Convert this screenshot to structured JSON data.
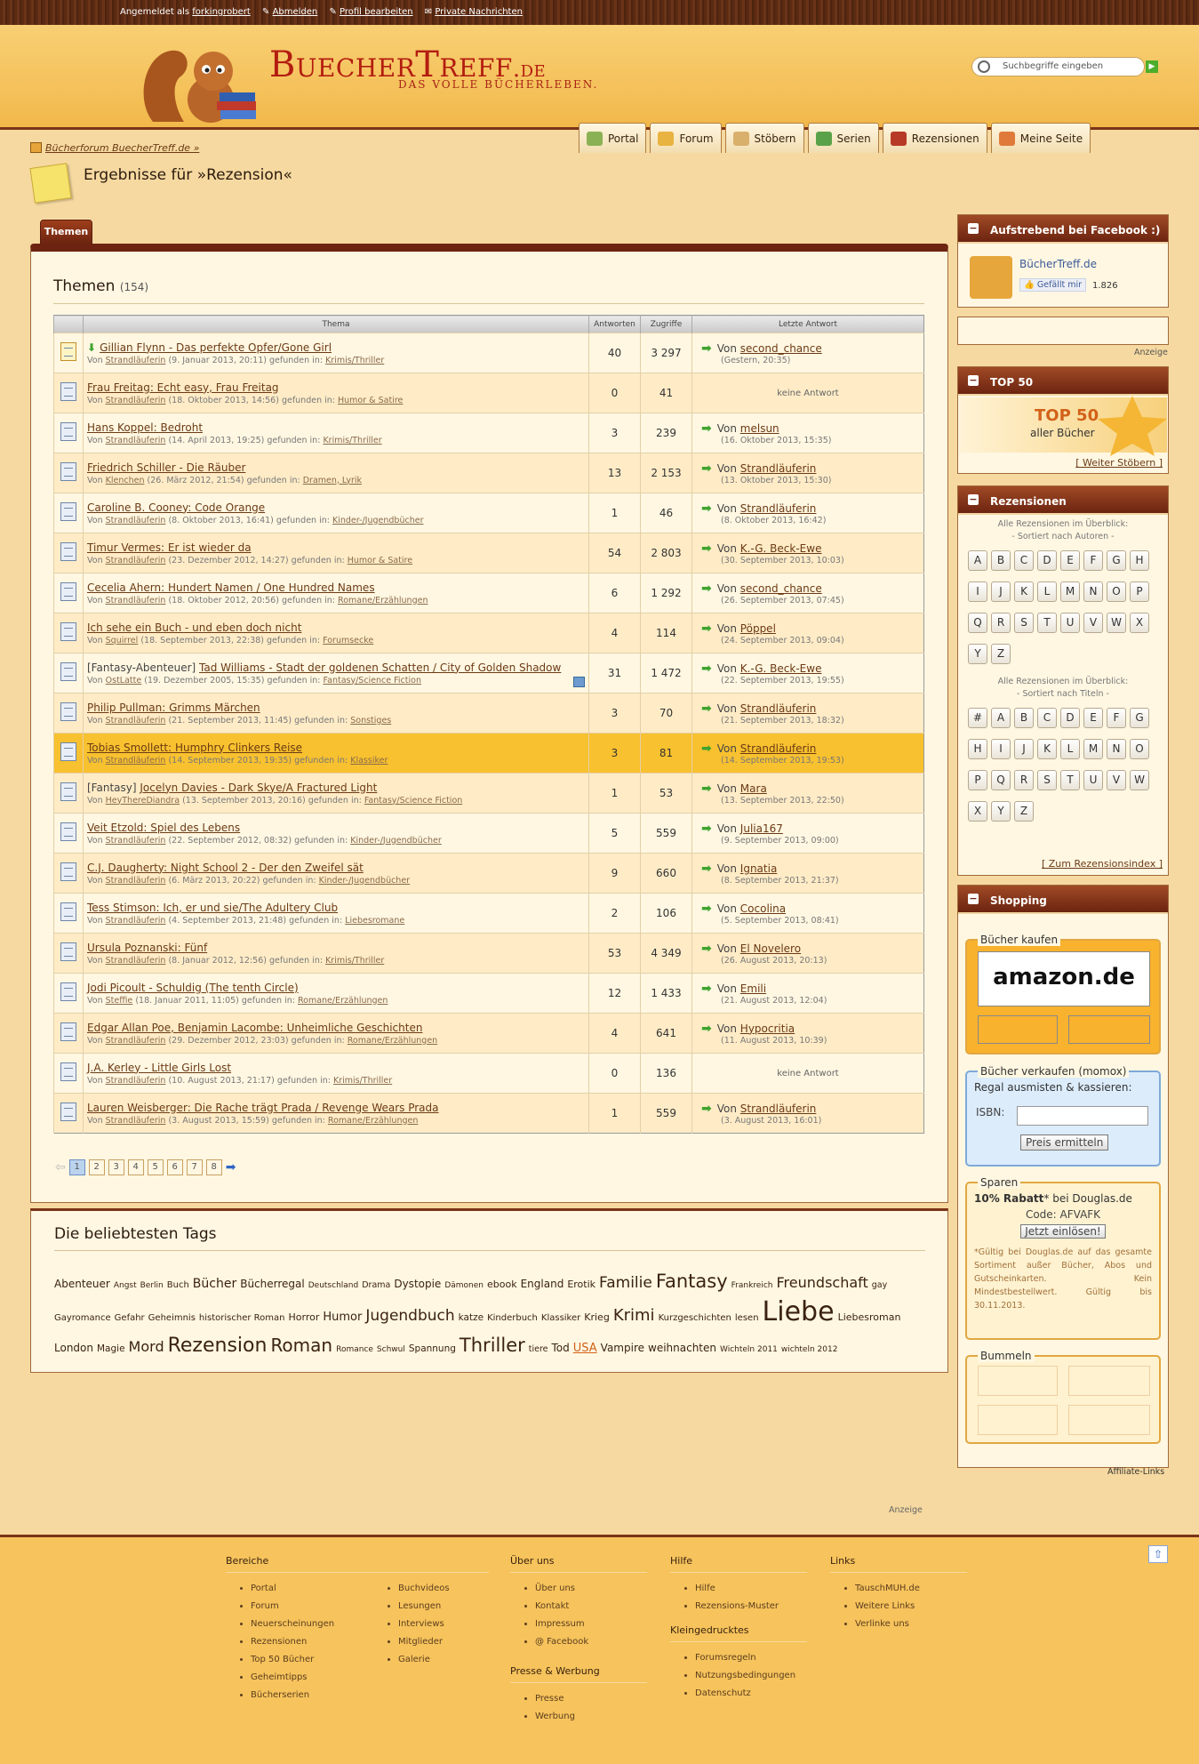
{
  "topbar": {
    "logged_in_as": "Angemeldet als",
    "user": "forkingrobert",
    "logout": "Abmelden",
    "profile": "Profil bearbeiten",
    "messages": "Private Nachrichten"
  },
  "header": {
    "logo_main": "BuecherTreff",
    "logo_tld": ".de",
    "tagline": "DAS VOLLE BÜCHERLEBEN.",
    "search_placeholder": "Suchbegriffe eingeben"
  },
  "nav": [
    "Portal",
    "Forum",
    "Stöbern",
    "Serien",
    "Rezensionen",
    "Meine Seite"
  ],
  "breadcrumb": "Bücherforum BuecherTreff.de »",
  "page_title": "Ergebnisse für »Rezension«",
  "tab": "Themen",
  "section": {
    "title": "Themen",
    "count": "(154)"
  },
  "columns": {
    "thema": "Thema",
    "antworten": "Antworten",
    "zugriffe": "Zugriffe",
    "letzte": "Letzte Antwort"
  },
  "rows": [
    {
      "pre": "",
      "title": "Gillian Flynn - Das perfekte Opfer/Gone Girl",
      "author": "Strandläuferin",
      "date": "(9. Januar 2013, 20:11)",
      "forum": "Krimis/Thriller",
      "replies": "40",
      "views": "3 297",
      "last_user": "second_chance",
      "last_date": "(Gestern, 20:35)",
      "hot": true
    },
    {
      "pre": "",
      "title": "Frau Freitag: Echt easy, Frau Freitag",
      "author": "Strandläuferin",
      "date": "(18. Oktober 2013, 14:56)",
      "forum": "Humor & Satire",
      "replies": "0",
      "views": "41",
      "last_user": "",
      "last_date": ""
    },
    {
      "pre": "",
      "title": "Hans Koppel: Bedroht",
      "author": "Strandläuferin",
      "date": "(14. April 2013, 19:25)",
      "forum": "Krimis/Thriller",
      "replies": "3",
      "views": "239",
      "last_user": "melsun",
      "last_date": "(16. Oktober 2013, 15:35)"
    },
    {
      "pre": "",
      "title": "Friedrich Schiller - Die Räuber",
      "author": "Klenchen",
      "date": "(26. März 2012, 21:54)",
      "forum": "Dramen, Lyrik",
      "replies": "13",
      "views": "2 153",
      "last_user": "Strandläuferin",
      "last_date": "(13. Oktober 2013, 15:30)"
    },
    {
      "pre": "",
      "title": "Caroline B. Cooney: Code Orange",
      "author": "Strandläuferin",
      "date": "(8. Oktober 2013, 16:41)",
      "forum": "Kinder-/Jugendbücher",
      "replies": "1",
      "views": "46",
      "last_user": "Strandläuferin",
      "last_date": "(8. Oktober 2013, 16:42)"
    },
    {
      "pre": "",
      "title": "Timur Vermes: Er ist wieder da",
      "author": "Strandläuferin",
      "date": "(23. Dezember 2012, 14:27)",
      "forum": "Humor & Satire",
      "replies": "54",
      "views": "2 803",
      "last_user": "K.-G. Beck-Ewe",
      "last_date": "(30. September 2013, 10:03)"
    },
    {
      "pre": "",
      "title": "Cecelia Ahern: Hundert Namen / One Hundred Names",
      "author": "Strandläuferin",
      "date": "(18. Oktober 2012, 20:56)",
      "forum": "Romane/Erzählungen",
      "replies": "6",
      "views": "1 292",
      "last_user": "second_chance",
      "last_date": "(26. September 2013, 07:45)"
    },
    {
      "pre": "",
      "title": "Ich sehe ein Buch - und eben doch nicht",
      "author": "Squirrel",
      "date": "(18. September 2013, 22:38)",
      "forum": "Forumsecke",
      "replies": "4",
      "views": "114",
      "last_user": "Pöppel",
      "last_date": "(24. September 2013, 09:04)"
    },
    {
      "pre": "[Fantasy-Abenteuer]",
      "title": "Tad Williams - Stadt der goldenen Schatten / City of Golden Shadow",
      "author": "OstLatte",
      "date": "(19. Dezember 2005, 15:35)",
      "forum": "Fantasy/Science Fiction",
      "replies": "31",
      "views": "1 472",
      "last_user": "K.-G. Beck-Ewe",
      "last_date": "(22. September 2013, 19:55)"
    },
    {
      "pre": "",
      "title": "Philip Pullman: Grimms Märchen",
      "author": "Strandläuferin",
      "date": "(21. September 2013, 11:45)",
      "forum": "Sonstiges",
      "replies": "3",
      "views": "70",
      "last_user": "Strandläuferin",
      "last_date": "(21. September 2013, 18:32)"
    },
    {
      "pre": "",
      "title": "Tobias Smollett: Humphry Clinkers Reise",
      "author": "Strandläuferin",
      "date": "(14. September 2013, 19:35)",
      "forum": "Klassiker",
      "replies": "3",
      "views": "81",
      "last_user": "Strandläuferin",
      "last_date": "(14. September 2013, 19:53)",
      "hl": true
    },
    {
      "pre": "[Fantasy]",
      "title": "Jocelyn Davies - Dark Skye/A Fractured Light",
      "author": "HeyThereDiandra",
      "date": "(13. September 2013, 20:16)",
      "forum": "Fantasy/Science Fiction",
      "replies": "1",
      "views": "53",
      "last_user": "Mara",
      "last_date": "(13. September 2013, 22:50)"
    },
    {
      "pre": "",
      "title": "Veit Etzold: Spiel des Lebens",
      "author": "Strandläuferin",
      "date": "(22. September 2012, 08:32)",
      "forum": "Kinder-/Jugendbücher",
      "replies": "5",
      "views": "559",
      "last_user": "Julia167",
      "last_date": "(9. September 2013, 09:00)"
    },
    {
      "pre": "",
      "title": "C.J. Daugherty: Night School 2 - Der den Zweifel sät",
      "author": "Strandläuferin",
      "date": "(6. März 2013, 20:22)",
      "forum": "Kinder-/Jugendbücher",
      "replies": "9",
      "views": "660",
      "last_user": "Ignatia",
      "last_date": "(8. September 2013, 21:37)"
    },
    {
      "pre": "",
      "title": "Tess Stimson: Ich, er und sie/The Adultery Club",
      "author": "Strandläuferin",
      "date": "(4. September 2013, 21:48)",
      "forum": "Liebesromane",
      "replies": "2",
      "views": "106",
      "last_user": "Cocolina",
      "last_date": "(5. September 2013, 08:41)"
    },
    {
      "pre": "",
      "title": "Ursula Poznanski: Fünf",
      "author": "Strandläuferin",
      "date": "(8. Januar 2012, 12:56)",
      "forum": "Krimis/Thriller",
      "replies": "53",
      "views": "4 349",
      "last_user": "El Novelero",
      "last_date": "(26. August 2013, 20:13)"
    },
    {
      "pre": "",
      "title": "Jodi Picoult - Schuldig (The tenth Circle)",
      "author": "Steffie",
      "date": "(18. Januar 2011, 11:05)",
      "forum": "Romane/Erzählungen",
      "replies": "12",
      "views": "1 433",
      "last_user": "Emili",
      "last_date": "(21. August 2013, 12:04)"
    },
    {
      "pre": "",
      "title": "Edgar Allan Poe, Benjamin Lacombe: Unheimliche Geschichten",
      "author": "Strandläuferin",
      "date": "(29. Dezember 2012, 23:03)",
      "forum": "Romane/Erzählungen",
      "replies": "4",
      "views": "641",
      "last_user": "Hypocritia",
      "last_date": "(11. August 2013, 10:39)"
    },
    {
      "pre": "",
      "title": "J.A. Kerley - Little Girls Lost",
      "author": "Strandläuferin",
      "date": "(10. August 2013, 21:17)",
      "forum": "Krimis/Thriller",
      "replies": "0",
      "views": "136",
      "last_user": "",
      "last_date": ""
    },
    {
      "pre": "",
      "title": "Lauren Weisberger: Die Rache trägt Prada / Revenge Wears Prada",
      "author": "Strandläuferin",
      "date": "(3. August 2013, 15:59)",
      "forum": "Romane/Erzählungen",
      "replies": "1",
      "views": "559",
      "last_user": "Strandläuferin",
      "last_date": "(3. August 2013, 16:01)"
    }
  ],
  "strings": {
    "von": "Von",
    "gefunden": "gefunden in:",
    "keine": "keine Antwort"
  },
  "pages": [
    "1",
    "2",
    "3",
    "4",
    "5",
    "6",
    "7",
    "8"
  ],
  "tags_title": "Die beliebtesten Tags",
  "tags": [
    [
      "Abenteuer",
      12
    ],
    [
      "Angst",
      9
    ],
    [
      "Berlin",
      9
    ],
    [
      "Buch",
      10
    ],
    [
      "Bücher",
      14
    ],
    [
      "Bücherregal",
      12
    ],
    [
      "Deutschland",
      9
    ],
    [
      "Drama",
      9.5
    ],
    [
      "Dystopie",
      12
    ],
    [
      "Dämonen",
      9
    ],
    [
      "ebook",
      11
    ],
    [
      "England",
      12
    ],
    [
      "Erotik",
      11
    ],
    [
      "Familie",
      17
    ],
    [
      "Fantasy",
      21
    ],
    [
      "Frankreich",
      9
    ],
    [
      "Freundschaft",
      16
    ],
    [
      "gay",
      9.5
    ],
    [
      "Gayromance",
      10
    ],
    [
      "Gefahr",
      10
    ],
    [
      "Geheimnis",
      10
    ],
    [
      "historischer Roman",
      10
    ],
    [
      "Horror",
      11
    ],
    [
      "Humor",
      13
    ],
    [
      "Jugendbuch",
      17
    ],
    [
      "katze",
      10.5
    ],
    [
      "Kinderbuch",
      10
    ],
    [
      "Klassiker",
      10
    ],
    [
      "Krieg",
      11
    ],
    [
      "Krimi",
      18
    ],
    [
      "Kurzgeschichten",
      10
    ],
    [
      "lesen",
      10
    ],
    [
      "Liebe",
      30
    ],
    [
      "Liebesroman",
      11
    ],
    [
      "London",
      12
    ],
    [
      "Magie",
      10.5
    ],
    [
      "Mord",
      16
    ],
    [
      "Rezension",
      22
    ],
    [
      "Roman",
      20
    ],
    [
      "Romance",
      9
    ],
    [
      "Schwul",
      9
    ],
    [
      "Spannung",
      10.5
    ],
    [
      "Thriller",
      21
    ],
    [
      "tiere",
      9.5
    ],
    [
      "Tod",
      12
    ],
    [
      "USA",
      13
    ],
    [
      "Vampire",
      12
    ],
    [
      "weihnachten",
      12
    ],
    [
      "Wichteln 2011",
      9
    ],
    [
      "wichteln 2012",
      9
    ]
  ],
  "sidebar": {
    "facebook": {
      "title": "Aufstrebend bei Facebook :)",
      "page": "BücherTreff.de",
      "like": "Gefällt mir",
      "count": "1.826"
    },
    "anzeige": "Anzeige",
    "top50": {
      "title": "TOP 50",
      "big": "TOP 50",
      "sub": "aller Bücher",
      "link": "[ Weiter Stöbern ]"
    },
    "reviews": {
      "title": "Rezensionen",
      "line1": "Alle Rezensionen im Überblick:",
      "line2": "- Sortiert nach Autoren -",
      "line3": "Alle Rezensionen im Überblick:",
      "line4": "- Sortiert nach Titeln -",
      "link": "[ Zum Rezensionsindex ]",
      "authors": [
        "A",
        "B",
        "C",
        "D",
        "E",
        "F",
        "G",
        "H",
        "I",
        "J",
        "K",
        "L",
        "M",
        "N",
        "O",
        "P",
        "Q",
        "R",
        "S",
        "T",
        "U",
        "V",
        "W",
        "X",
        "Y",
        "Z"
      ],
      "titles": [
        "#",
        "A",
        "B",
        "C",
        "D",
        "E",
        "F",
        "G",
        "H",
        "I",
        "J",
        "K",
        "L",
        "M",
        "N",
        "O",
        "P",
        "Q",
        "R",
        "S",
        "T",
        "U",
        "V",
        "W",
        "X",
        "Y",
        "Z"
      ]
    },
    "shopping": {
      "title": "Shopping",
      "buy": "Bücher kaufen",
      "amazon": "amazon.de",
      "sell": "Bücher verkaufen (momox)",
      "sell_sub": "Regal ausmisten & kassieren:",
      "isbn": "ISBN:",
      "price_btn": "Preis ermitteln",
      "save": "Sparen",
      "rabatt": "10% Rabatt",
      "rabatt2": "* bei Douglas.de",
      "code": "Code: AFVAFK",
      "redeem": "Jetzt einlösen!",
      "fine": "*Gültig bei Douglas.de auf das gesamte Sortiment außer Bücher, Abos und Gutscheinkarten. Kein Mindestbestellwert. Gültig bis 30.11.2013.",
      "bummeln": "Bummeln",
      "affiliate": "Affiliate-Links"
    }
  },
  "anzeige2": "Anzeige",
  "footer": {
    "bereiche": {
      "title": "Bereiche",
      "a": [
        "Portal",
        "Forum",
        "Neuerscheinungen",
        "Rezensionen",
        "Top 50 Bücher",
        "Geheimtipps",
        "Bücherserien"
      ],
      "b": [
        "Buchvideos",
        "Lesungen",
        "Interviews",
        "Mitglieder",
        "Galerie"
      ]
    },
    "ueber": {
      "title": "Über uns",
      "items": [
        "Über uns",
        "Kontakt",
        "Impressum",
        "@ Facebook"
      ]
    },
    "presse": {
      "title": "Presse & Werbung",
      "items": [
        "Presse",
        "Werbung"
      ]
    },
    "hilfe": {
      "title": "Hilfe",
      "items": [
        "Hilfe",
        "Rezensions-Muster"
      ]
    },
    "klein": {
      "title": "Kleingedrucktes",
      "items": [
        "Forumsregeln",
        "Nutzungsbedingungen",
        "Datenschutz"
      ]
    },
    "links": {
      "title": "Links",
      "items": [
        "TauschMUH.de",
        "Weitere Links",
        "Verlinke uns"
      ]
    }
  }
}
